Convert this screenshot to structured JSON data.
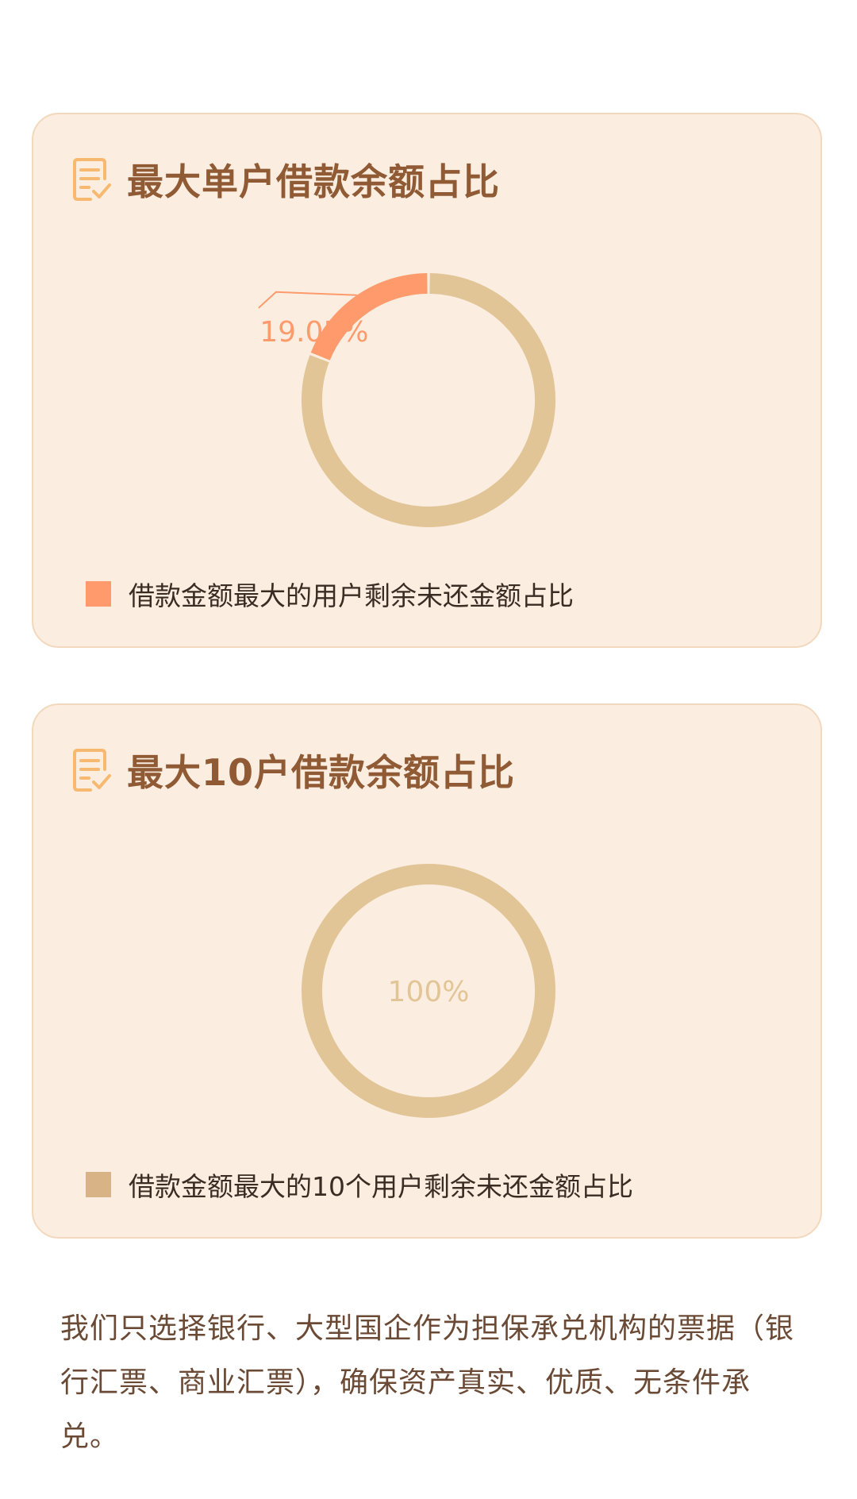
{
  "colors": {
    "card_background": "#fbeee1",
    "card_border": "#f2d8bd",
    "title": "#8f5a34",
    "icon": "#f7b86f",
    "highlight_slice": "#fe9a6b",
    "remainder_slice": "#e2c597",
    "legend_swatch_2": "#d8b386",
    "footer_text": "#6b4a35"
  },
  "cards": [
    {
      "icon": "document-check-icon",
      "title": "最大单户借款余额占比",
      "legend_label": "借款金额最大的用户剩余未还金额占比"
    },
    {
      "icon": "document-check-icon",
      "title": "最大10户借款余额占比",
      "legend_label": "借款金额最大的10个用户剩余未还金额占比"
    }
  ],
  "chart_data": [
    {
      "type": "pie",
      "donut": true,
      "slices": [
        {
          "label": "借款金额最大的用户剩余未还金额占比",
          "value": 19.05,
          "display": "19.05%",
          "color": "#fe9a6b",
          "labeled": true
        },
        {
          "label": "",
          "value": 80.95,
          "display": "",
          "color": "#e2c597",
          "labeled": false
        }
      ],
      "legend_position": "bottom-left"
    },
    {
      "type": "pie",
      "donut": true,
      "slices": [
        {
          "label": "借款金额最大的10个用户剩余未还金额占比",
          "value": 100,
          "display": "100%",
          "color": "#e2c597",
          "labeled": true
        }
      ],
      "legend_position": "bottom-left"
    }
  ],
  "footer": {
    "text": "我们只选择银行、大型国企作为担保承兑机构的票据（银行汇票、商业汇票），确保资产真实、优质、无条件承兑。"
  }
}
